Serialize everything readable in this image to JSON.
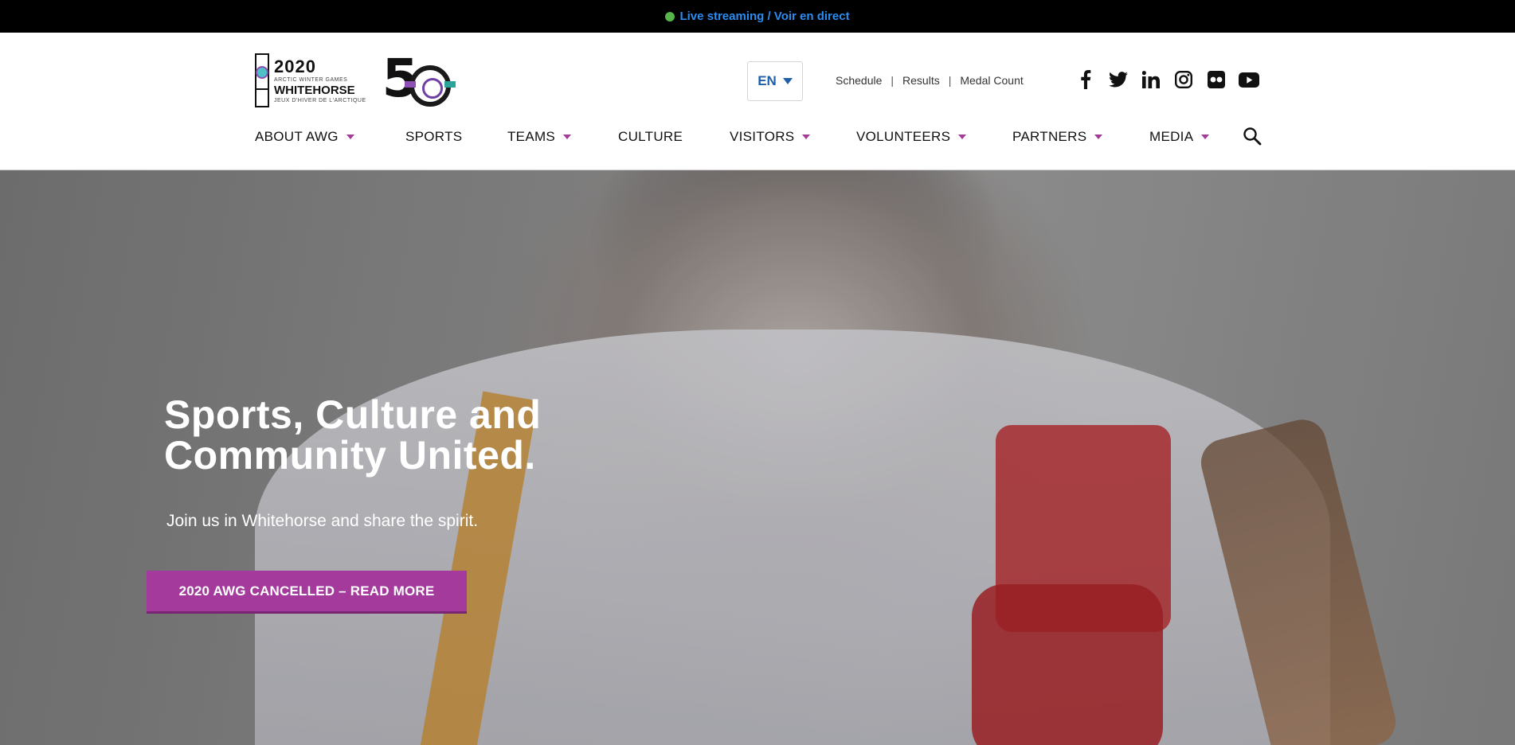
{
  "live_bar": {
    "text": "Live streaming / Voir en direct",
    "dot_color": "#56b44a",
    "link_color": "#2a8cf0"
  },
  "logo": {
    "year": "2020",
    "subtitle_top": "ARCTIC WINTER GAMES",
    "city": "WHITEHORSE",
    "subtitle_bottom": "JEUX D'HIVER DE L'ARCTIQUE",
    "anniversary": "5"
  },
  "language": {
    "selected": "EN"
  },
  "utility_links": [
    "Schedule",
    "Results",
    "Medal Count"
  ],
  "social_icons": [
    "facebook-icon",
    "twitter-icon",
    "linkedin-icon",
    "instagram-icon",
    "flickr-icon",
    "youtube-icon"
  ],
  "nav": {
    "items": [
      {
        "label": "ABOUT AWG",
        "dropdown": true
      },
      {
        "label": "SPORTS",
        "dropdown": false
      },
      {
        "label": "TEAMS",
        "dropdown": true
      },
      {
        "label": "CULTURE",
        "dropdown": false
      },
      {
        "label": "VISITORS",
        "dropdown": true
      },
      {
        "label": "VOLUNTEERS",
        "dropdown": true
      },
      {
        "label": "PARTNERS",
        "dropdown": true
      },
      {
        "label": "MEDIA",
        "dropdown": true
      }
    ],
    "search_icon": "search-icon",
    "caret_color": "#a33a9c"
  },
  "hero": {
    "title_line1": "Sports, Culture and",
    "title_line2": "Community United.",
    "subtitle": "Join us in Whitehorse and share the spirit.",
    "button_label": "2020 AWG CANCELLED – READ MORE",
    "button_color": "#a33a9c"
  }
}
